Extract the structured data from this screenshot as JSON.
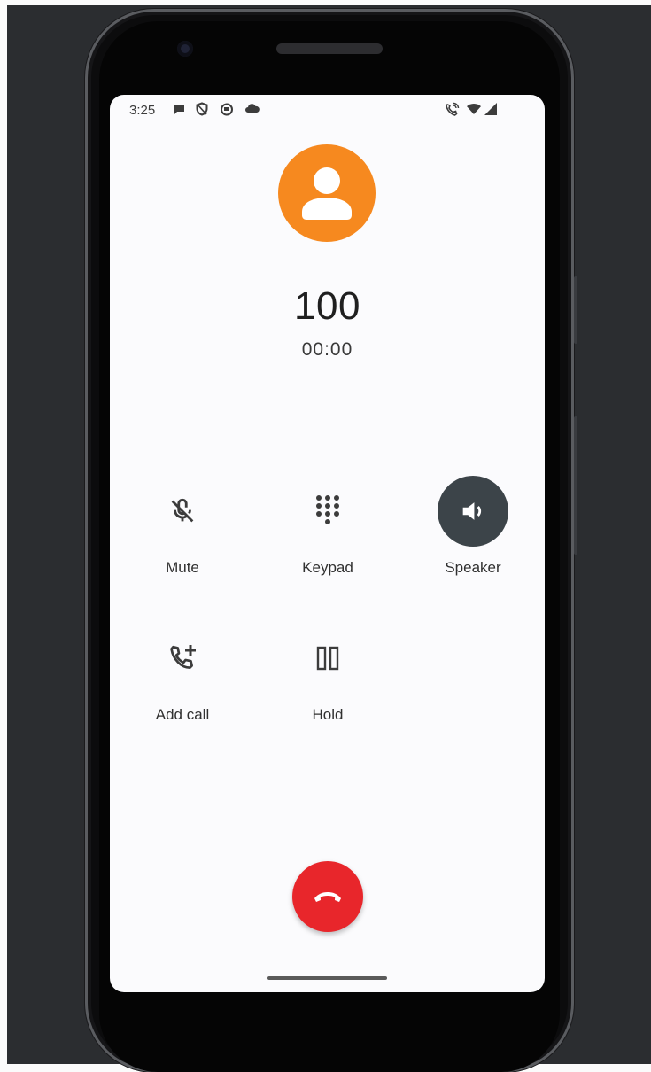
{
  "status_bar": {
    "time": "3:25",
    "left_icons": [
      "message-icon",
      "shield-icon",
      "robot-icon",
      "cloud-icon"
    ],
    "right_icons": [
      "wifi-call-icon",
      "wifi-icon",
      "signal-icon"
    ]
  },
  "call": {
    "avatar_icon": "person-icon",
    "number": "100",
    "timer": "00:00"
  },
  "controls": [
    {
      "label": "Mute",
      "icon": "mic-off-icon",
      "active": false
    },
    {
      "label": "Keypad",
      "icon": "dialpad-icon",
      "active": false
    },
    {
      "label": "Speaker",
      "icon": "volume-icon",
      "active": true
    },
    {
      "label": "Add call",
      "icon": "add-call-icon",
      "active": false
    },
    {
      "label": "Hold",
      "icon": "pause-icon",
      "active": false
    }
  ],
  "end_call": {
    "icon": "call-end-icon"
  },
  "colors": {
    "avatar": "#f6891f",
    "end_call": "#e8262b",
    "active_control": "#3c4449",
    "screen_bg": "#fbfbfd",
    "backdrop": "#2b2d30"
  }
}
